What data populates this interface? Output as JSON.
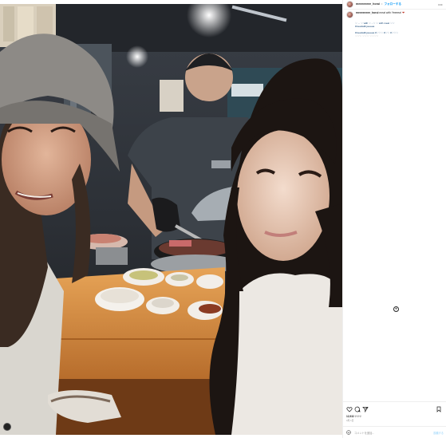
{
  "post": {
    "username": "meeeeeeee_horui",
    "separator": "•",
    "follow_label": "フォローする",
    "more_icon": "more-horizontal-icon",
    "caption": {
      "username": "meeeeeeee_horui",
      "text": "meat with Yeeeea!",
      "emoji": "❤"
    },
    "caption_lines": [
      "♡ ... ♡ with ♡ - ♡ ♡ with meat ♡♡",
      "#meatwithyeeeea",
      "#meatwithyeeeea #♡♡♡ #♡♡ #♡♡♡",
      "♡♡♡ ♡♡♡ ♡♡♡♡"
    ],
    "likes": "12,932 ♡♡♡",
    "date": "3月 1日",
    "comment_placeholder": "コメントを追加...",
    "post_label": "投稿する",
    "icons": {
      "like": "heart-icon",
      "comment": "comment-icon",
      "share": "send-icon",
      "save": "bookmark-icon",
      "emoji": "smiley-icon",
      "add": "plus-circle-icon"
    },
    "colors": {
      "accent": "#0095f6",
      "link": "#00376b",
      "muted": "#8e8e8e"
    }
  }
}
